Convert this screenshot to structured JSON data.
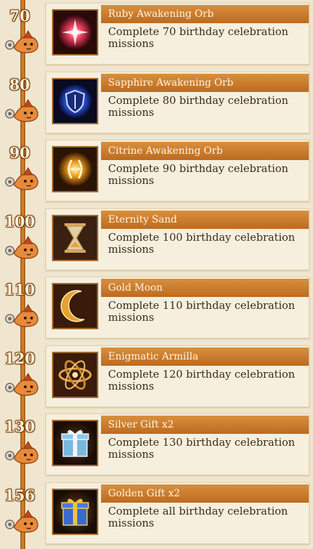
{
  "rewards": [
    {
      "milestone": "70",
      "title": "Ruby Awakening Orb",
      "desc": "Complete 70 birthday celebration missions",
      "icon": "ruby-orb-icon"
    },
    {
      "milestone": "80",
      "title": "Sapphire Awakening Orb",
      "desc": "Complete 80 birthday celebration missions",
      "icon": "sapphire-orb-icon"
    },
    {
      "milestone": "90",
      "title": "Citrine Awakening Orb",
      "desc": "Complete 90 birthday celebration missions",
      "icon": "citrine-orb-icon"
    },
    {
      "milestone": "100",
      "title": "Eternity Sand",
      "desc": "Complete 100 birthday celebration missions",
      "icon": "hourglass-icon"
    },
    {
      "milestone": "110",
      "title": "Gold Moon",
      "desc": "Complete 110 birthday celebration missions",
      "icon": "gold-moon-icon"
    },
    {
      "milestone": "120",
      "title": "Enigmatic Armilla",
      "desc": "Complete 120 birthday celebration missions",
      "icon": "armillary-sphere-icon"
    },
    {
      "milestone": "130",
      "title": "Silver Gift x2",
      "desc": "Complete 130 birthday celebration missions",
      "icon": "silver-gift-icon"
    },
    {
      "milestone": "156",
      "title": "Golden Gift x2",
      "desc": "Complete all birthday celebration missions",
      "icon": "golden-gift-icon"
    }
  ]
}
